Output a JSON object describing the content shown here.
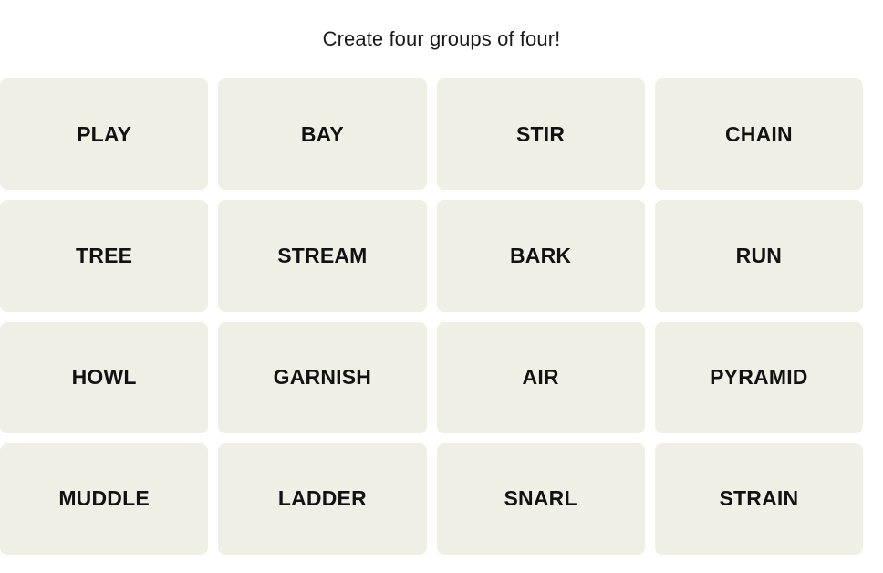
{
  "instruction": "Create four groups of four!",
  "colors": {
    "page_background": "#ffffff",
    "tile_background": "#efefe6",
    "tile_text": "#121213",
    "instruction_text": "#1a1a1a"
  },
  "grid": {
    "columns": 4,
    "rows": 4,
    "tiles": [
      {
        "word": "PLAY"
      },
      {
        "word": "BAY"
      },
      {
        "word": "STIR"
      },
      {
        "word": "CHAIN"
      },
      {
        "word": "TREE"
      },
      {
        "word": "STREAM"
      },
      {
        "word": "BARK"
      },
      {
        "word": "RUN"
      },
      {
        "word": "HOWL"
      },
      {
        "word": "GARNISH"
      },
      {
        "word": "AIR"
      },
      {
        "word": "PYRAMID"
      },
      {
        "word": "MUDDLE"
      },
      {
        "word": "LADDER"
      },
      {
        "word": "SNARL"
      },
      {
        "word": "STRAIN"
      }
    ]
  }
}
